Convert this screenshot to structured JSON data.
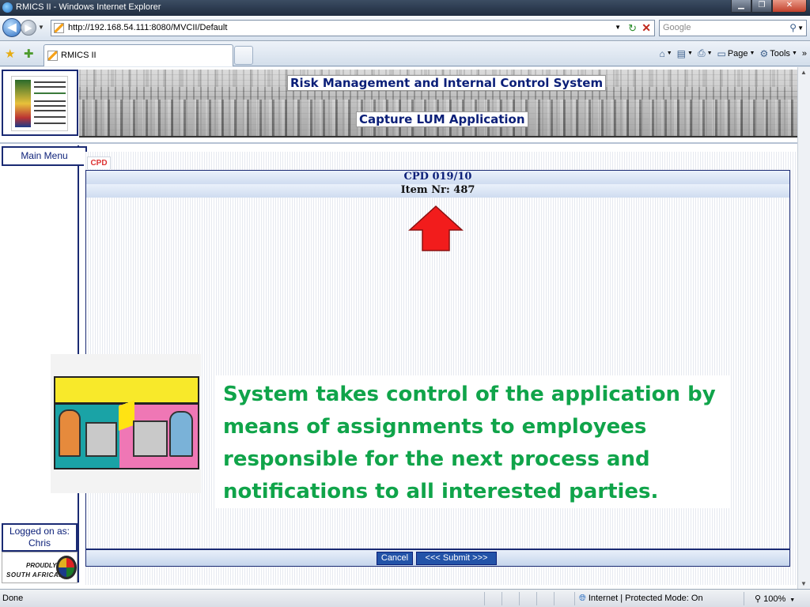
{
  "browser": {
    "title": "RMICS II - Windows Internet Explorer",
    "address": "http://192.168.54.111:8080/MVCII/Default",
    "search_placeholder": "Google",
    "tab_label": "RMICS II",
    "commands": {
      "page": "Page",
      "tools": "Tools"
    }
  },
  "header": {
    "title1": "Risk Management and Internal Control System",
    "title2": "Capture LUM Application"
  },
  "sidebar": {
    "main_menu": "Main Menu",
    "logged_on_label": "Logged on as:",
    "user": "Chris",
    "badge_line1": "PROUDLY",
    "badge_line2": "SOUTH AFRICAN"
  },
  "form": {
    "tab": "CPD",
    "ref": "CPD 019/10",
    "item": "Item Nr: 487",
    "cancel": "Cancel",
    "submit": "<<< Submit >>>"
  },
  "callout": {
    "text": "System takes control of the application by means of assignments to employees responsible for the next process  and notifications to all interested parties.",
    "color": "#10a44a"
  },
  "status": {
    "left": "Done",
    "zone": "Internet | Protected Mode: On",
    "zoom": "100%"
  }
}
